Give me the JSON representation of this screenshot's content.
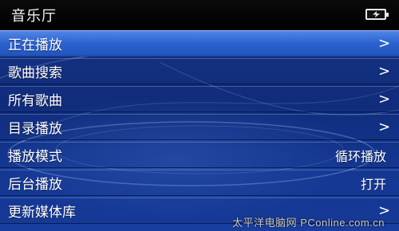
{
  "header": {
    "title": "音乐厅",
    "battery_icon": "battery-charging-icon"
  },
  "menu": {
    "items": [
      {
        "label": "正在播放",
        "value": "",
        "has_chevron": true,
        "selected": true
      },
      {
        "label": "歌曲搜索",
        "value": "",
        "has_chevron": true,
        "selected": false
      },
      {
        "label": "所有歌曲",
        "value": "",
        "has_chevron": true,
        "selected": false
      },
      {
        "label": "目录播放",
        "value": "",
        "has_chevron": true,
        "selected": false
      },
      {
        "label": "播放模式",
        "value": "循环播放",
        "has_chevron": false,
        "selected": false
      },
      {
        "label": "后台播放",
        "value": "打开",
        "has_chevron": false,
        "selected": false
      },
      {
        "label": "更新媒体库",
        "value": "",
        "has_chevron": true,
        "selected": false
      }
    ],
    "chevron_glyph": ">"
  },
  "watermark": {
    "text": "太平洋电脑网 PConline.com.cn"
  },
  "colors": {
    "selected_bg": "#2c62cf",
    "menu_bg": "#143b95",
    "title_bg": "#000000",
    "text": "#ffffff"
  }
}
